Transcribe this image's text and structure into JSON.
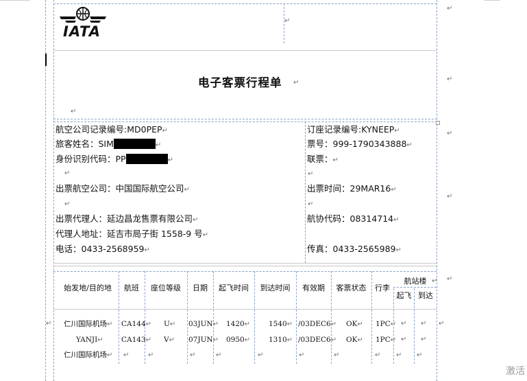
{
  "logo": {
    "text": "IATA"
  },
  "doc_title": "电子客票行程单",
  "left_info": {
    "airline_record": "航空公司记录编号:MD0PEP",
    "passenger_label": "旅客姓名：SIM",
    "id_label": "身份识别代码：PP",
    "issuing_airline": "出票航空公司：中国国际航空公司",
    "issuing_agent": "出票代理人：延边昌龙售票有限公司",
    "agent_address": "代理人地址：延吉市局子街 1558-9 号",
    "phone": "电话：0433-2568959"
  },
  "right_info": {
    "booking_record": "订座记录编号:KYNEEP",
    "ticket_no": "票号：999-1790343888",
    "conjunction": "联票：",
    "issue_time": "出票时间：29MAR16",
    "iata_code": "航协代码：08314714",
    "fax": "传真：0433-2565989"
  },
  "table": {
    "headers": {
      "route": "始发地/目的地",
      "flight": "航班",
      "class": "座位等级",
      "date": "日期",
      "dep_time": "起飞时间",
      "arr_time": "到达时间",
      "validity": "有效期",
      "status": "客票状态",
      "baggage": "行李",
      "terminal": "航站楼",
      "terminal_dep": "起飞",
      "terminal_arr": "到达"
    },
    "rows": [
      {
        "route": "仁川国际机场",
        "flight": "CA144",
        "class": "U",
        "date": "03JUN",
        "dep": "1420",
        "arr": "1540",
        "valid": "/03DEC6",
        "status": "OK",
        "bag": "1PC"
      },
      {
        "route": "YANJI",
        "flight": "CA143",
        "class": "V",
        "date": "07JUN",
        "dep": "0950",
        "arr": "1310",
        "valid": "/03DEC6",
        "status": "OK",
        "bag": "1PC"
      },
      {
        "route": "仁川国际机场"
      }
    ]
  },
  "watermark": "激活"
}
